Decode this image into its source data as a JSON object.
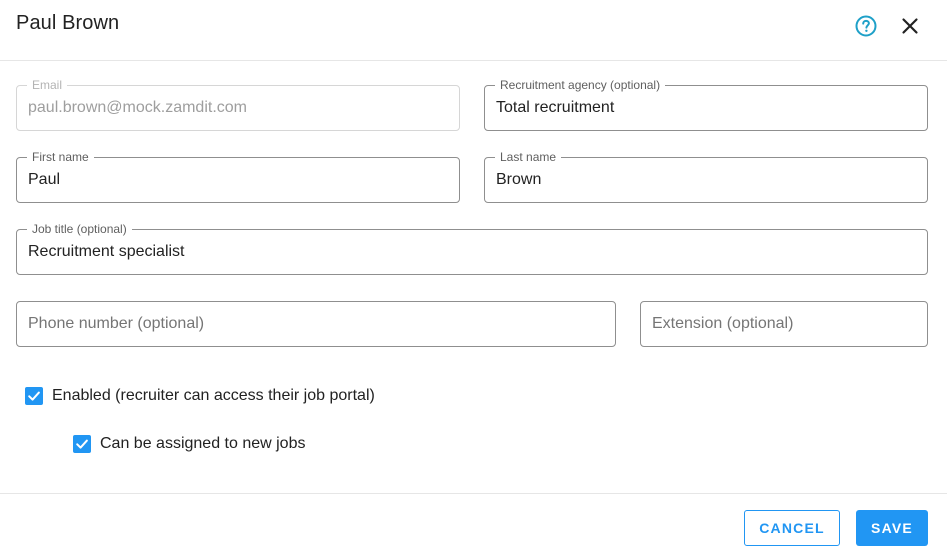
{
  "dialog": {
    "title": "Paul Brown"
  },
  "icons": {
    "help": "help-circle-icon",
    "close": "close-icon",
    "check": "check-icon"
  },
  "colors": {
    "accent": "#2196f3",
    "help_icon": "#1ea0c8"
  },
  "form": {
    "email": {
      "label": "Email",
      "value": "paul.brown@mock.zamdit.com",
      "disabled": true
    },
    "agency": {
      "label": "Recruitment agency (optional)",
      "value": "Total recruitment"
    },
    "first_name": {
      "label": "First name",
      "value": "Paul"
    },
    "last_name": {
      "label": "Last name",
      "value": "Brown"
    },
    "job_title": {
      "label": "Job title (optional)",
      "value": "Recruitment specialist"
    },
    "phone": {
      "placeholder": "Phone number (optional)",
      "value": ""
    },
    "extension": {
      "placeholder": "Extension (optional)",
      "value": ""
    }
  },
  "checkboxes": {
    "enabled": {
      "label": "Enabled (recruiter can access their job portal)",
      "checked": true
    },
    "assignable": {
      "label": "Can be assigned to new jobs",
      "checked": true
    }
  },
  "footer": {
    "cancel_label": "CANCEL",
    "save_label": "SAVE"
  }
}
